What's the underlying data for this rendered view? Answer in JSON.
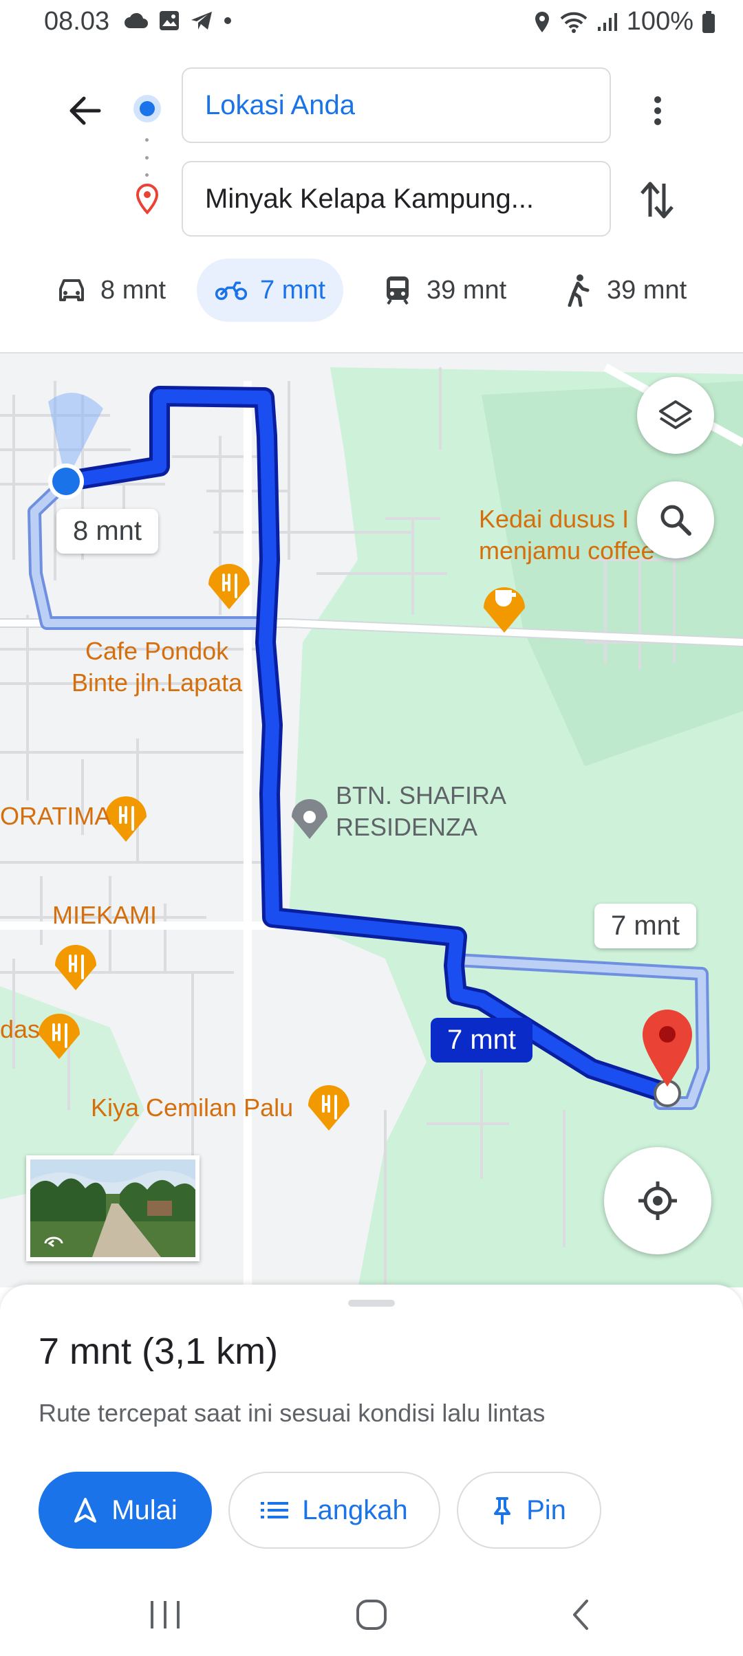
{
  "status_bar": {
    "time": "08.03",
    "battery": "100%",
    "icons": [
      "cloud-icon",
      "gallery-icon",
      "telegram-icon",
      "dot-icon",
      "location-icon",
      "wifi-icon",
      "signal-icon",
      "battery-icon"
    ]
  },
  "header": {
    "origin": "Lokasi Anda",
    "destination": "Minyak Kelapa Kampung...",
    "modes": [
      {
        "name": "car",
        "label": "8 mnt"
      },
      {
        "name": "motorcycle",
        "label": "7 mnt",
        "active": true
      },
      {
        "name": "transit",
        "label": "39 mnt"
      },
      {
        "name": "walk",
        "label": "39 mnt"
      }
    ]
  },
  "map": {
    "pois": [
      {
        "line1": "Kedai dusus I",
        "line2": "menjamu coffee"
      },
      {
        "line1": "Cafe Pondok",
        "line2": "Binte jln.Lapata"
      },
      {
        "line1": "BTN. SHAFIRA",
        "line2": "RESIDENZA"
      },
      {
        "line1": "ORATIMA"
      },
      {
        "line1": "MIEKAMI"
      },
      {
        "line1": "das"
      },
      {
        "line1": "Kiya Cemilan Palu"
      }
    ],
    "route_labels": {
      "alt_left": "8 mnt",
      "alt_right": "7 mnt",
      "primary": "7 mnt"
    }
  },
  "summary": {
    "title": "7 mnt (3,1 km)",
    "description": "Rute tercepat saat ini sesuai kondisi lalu lintas"
  },
  "actions": {
    "start": "Mulai",
    "steps": "Langkah",
    "pin": "Pin"
  },
  "colors": {
    "accent": "#1a73e8",
    "route_primary": "#0b2bc8",
    "route_alt": "#a8c7fa",
    "park": "#cdf1d9",
    "poi": "#f29900",
    "destination_pin": "#ea4335"
  }
}
